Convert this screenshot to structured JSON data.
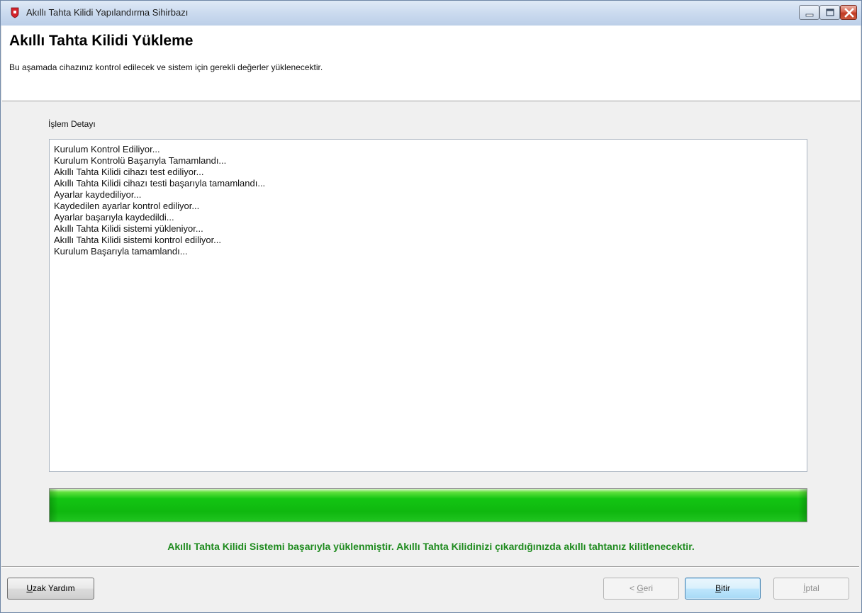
{
  "window": {
    "title": "Akıllı Tahta Kilidi Yapılandırma Sihirbazı"
  },
  "header": {
    "title": "Akıllı Tahta Kilidi Yükleme",
    "subtitle": "Bu aşamada cihazınız kontrol edilecek ve sistem için gerekli değerler yüklenecektir."
  },
  "detail": {
    "label": "İşlem Detayı",
    "lines": [
      "Kurulum Kontrol Ediliyor...",
      "Kurulum Kontrolü Başarıyla Tamamlandı...",
      "Akıllı Tahta Kilidi cihazı test ediliyor...",
      "Akıllı Tahta Kilidi cihazı testi başarıyla tamamlandı...",
      "Ayarlar kaydediliyor...",
      "Kaydedilen ayarlar kontrol ediliyor...",
      "Ayarlar başarıyla kaydedildi...",
      "Akıllı Tahta Kilidi sistemi yükleniyor...",
      "Akıllı Tahta Kilidi sistemi kontrol ediliyor...",
      "Kurulum Başarıyla tamamlandı..."
    ]
  },
  "progress": {
    "percent": 100,
    "color": "#13c513"
  },
  "status": {
    "message": "Akıllı Tahta Kilidi Sistemi başarıyla yüklenmiştir. Akıllı Tahta Kilidinizi çıkardığınızda akıllı tahtanız kilitlenecektir.",
    "color": "#1f8b1f"
  },
  "buttons": {
    "help_mnemonic": "U",
    "help_rest": "zak Yardım",
    "back_prefix": "< ",
    "back_mnemonic": "G",
    "back_rest": "eri",
    "finish_mnemonic": "B",
    "finish_rest": "itir",
    "cancel_mnemonic": "İ",
    "cancel_rest": "ptal"
  },
  "icons": {
    "app": "shield-lock-icon",
    "minimize": "minimize-icon",
    "maximize": "maximize-icon",
    "close": "close-icon"
  }
}
